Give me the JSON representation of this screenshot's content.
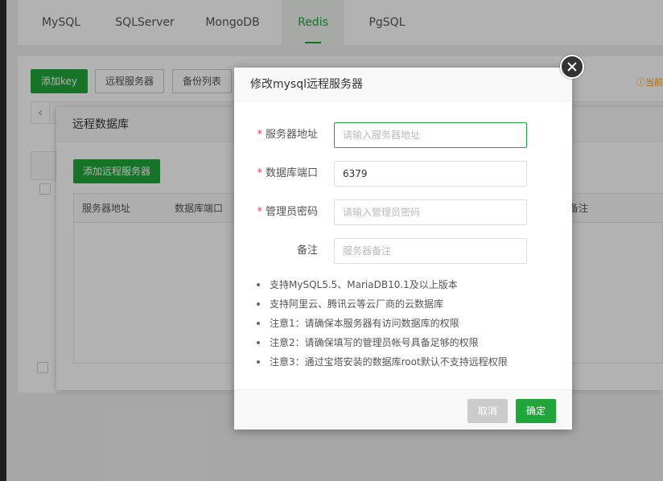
{
  "tabs": [
    {
      "label": "MySQL"
    },
    {
      "label": "SQLServer"
    },
    {
      "label": "MongoDB"
    },
    {
      "label": "Redis",
      "active": true
    },
    {
      "label": "PgSQL"
    }
  ],
  "toolbar": {
    "add_key": "添加key",
    "remote_server": "远程服务器",
    "backup_list": "备份列表",
    "current_hint": "当前"
  },
  "remote_db": {
    "title": "远程数据库",
    "add_button": "添加远程服务器",
    "columns": [
      "服务器地址",
      "数据库端口",
      "备注"
    ]
  },
  "modal": {
    "title": "修改mysql远程服务器",
    "fields": {
      "server_address": {
        "label": "服务器地址",
        "required": true,
        "value": "",
        "placeholder": "请输入服务器地址"
      },
      "db_port": {
        "label": "数据库端口",
        "required": true,
        "value": "6379",
        "placeholder": ""
      },
      "admin_password": {
        "label": "管理员密码",
        "required": true,
        "value": "",
        "placeholder": "请输入管理员密码"
      },
      "remark": {
        "label": "备注",
        "required": false,
        "value": "",
        "placeholder": "服务器备注"
      }
    },
    "required_mark": "*",
    "notes": [
      "支持MySQL5.5、MariaDB10.1及以上版本",
      "支持阿里云、腾讯云等云厂商的云数据库",
      "注意1：请确保本服务器有访问数据库的权限",
      "注意2：请确保填写的管理员帐号具备足够的权限",
      "注意3：通过宝塔安装的数据库root默认不支持远程权限"
    ],
    "cancel_label": "取消",
    "confirm_label": "确定"
  },
  "colors": {
    "accent": "#20a53a",
    "required": "#e64545",
    "cancel_bg": "#cbcbcb"
  }
}
